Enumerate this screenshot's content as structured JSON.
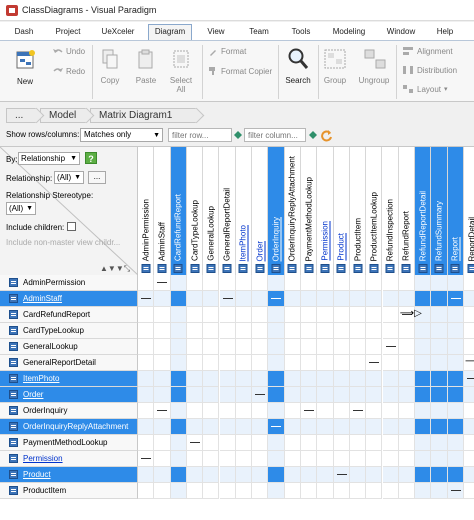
{
  "window": {
    "title": "ClassDiagrams - Visual Paradigm"
  },
  "menu": {
    "tabs": [
      {
        "label": "Dash",
        "active": false
      },
      {
        "label": "Project",
        "active": false
      },
      {
        "label": "UeXceler",
        "active": false
      },
      {
        "label": "Diagram",
        "active": true
      },
      {
        "label": "View",
        "active": false
      },
      {
        "label": "Team",
        "active": false
      },
      {
        "label": "Tools",
        "active": false
      },
      {
        "label": "Modeling",
        "active": false
      },
      {
        "label": "Window",
        "active": false
      },
      {
        "label": "Help",
        "active": false
      }
    ]
  },
  "ribbon": {
    "new": "New",
    "undo": "Undo",
    "redo": "Redo",
    "copy": "Copy",
    "paste": "Paste",
    "select_all": "Select",
    "select_all_line2": "All",
    "format": "Format",
    "format_copier": "Format Copier",
    "search": "Search",
    "group": "Group",
    "ungroup": "Ungroup",
    "alignment": "Alignment",
    "distribution": "Distribution",
    "layout": "Layout"
  },
  "breadcrumbs": {
    "ellipsis": "...",
    "model": "Model",
    "diagram": "Matrix Diagram1"
  },
  "filter": {
    "label": "Show rows/columns:",
    "value": "Matches only",
    "row_placeholder": "filter row...",
    "column_placeholder": "filter column..."
  },
  "corner": {
    "by_label": "By:",
    "by_value": "Relationship",
    "relationship_label": "Relationship:",
    "relationship_value": "(All)",
    "more_button": "...",
    "stereotype_label": "Relationship Stereotype:",
    "stereotype_value": "(All)",
    "include_children": "Include children:",
    "include_nonmaster": "Include non-master view childr...",
    "help": "?"
  },
  "columns": [
    {
      "name": "AdminPermission",
      "selected": false,
      "link": false
    },
    {
      "name": "AdminStaff",
      "selected": false,
      "link": false
    },
    {
      "name": "CardRefundReport",
      "selected": true,
      "link": false
    },
    {
      "name": "CardTypeLookup",
      "selected": false,
      "link": false
    },
    {
      "name": "GeneralLookup",
      "selected": false,
      "link": false
    },
    {
      "name": "GeneralReportDetail",
      "selected": false,
      "link": false
    },
    {
      "name": "ItemPhoto",
      "selected": false,
      "link": true
    },
    {
      "name": "Order",
      "selected": false,
      "link": true
    },
    {
      "name": "OrderInquiry",
      "selected": true,
      "link": true
    },
    {
      "name": "OrderInquiryReplyAttachment",
      "selected": false,
      "link": false
    },
    {
      "name": "PaymentMethodLookup",
      "selected": false,
      "link": false
    },
    {
      "name": "Permission",
      "selected": false,
      "link": true
    },
    {
      "name": "Product",
      "selected": false,
      "link": true
    },
    {
      "name": "ProductItem",
      "selected": false,
      "link": false
    },
    {
      "name": "ProductItemLookup",
      "selected": false,
      "link": false
    },
    {
      "name": "RefundInspection",
      "selected": false,
      "link": false
    },
    {
      "name": "RefundReport",
      "selected": false,
      "link": false
    },
    {
      "name": "RefundReportDetail",
      "selected": true,
      "link": false
    },
    {
      "name": "RefundSummary",
      "selected": true,
      "link": false
    },
    {
      "name": "Report",
      "selected": true,
      "link": true
    },
    {
      "name": "ReportDetail",
      "selected": false,
      "link": false
    }
  ],
  "rows": [
    {
      "name": "AdminPermission",
      "selected": false,
      "link": false
    },
    {
      "name": "AdminStaff",
      "selected": true,
      "link": true
    },
    {
      "name": "CardRefundReport",
      "selected": false,
      "link": false
    },
    {
      "name": "CardTypeLookup",
      "selected": false,
      "link": false
    },
    {
      "name": "GeneralLookup",
      "selected": false,
      "link": false
    },
    {
      "name": "GeneralReportDetail",
      "selected": false,
      "link": false
    },
    {
      "name": "ItemPhoto",
      "selected": true,
      "link": true
    },
    {
      "name": "Order",
      "selected": true,
      "link": true
    },
    {
      "name": "OrderInquiry",
      "selected": false,
      "link": false
    },
    {
      "name": "OrderInquiryReplyAttachment",
      "selected": true,
      "link": false
    },
    {
      "name": "PaymentMethodLookup",
      "selected": false,
      "link": false
    },
    {
      "name": "Permission",
      "selected": false,
      "link": true
    },
    {
      "name": "Product",
      "selected": true,
      "link": true
    },
    {
      "name": "ProductItem",
      "selected": false,
      "link": false
    }
  ],
  "dashes": [
    [
      0,
      1
    ],
    [
      1,
      0
    ],
    [
      1,
      5
    ],
    [
      1,
      8
    ],
    [
      1,
      19
    ],
    [
      2,
      16
    ],
    [
      4,
      15
    ],
    [
      5,
      14
    ],
    [
      6,
      20
    ],
    [
      7,
      7
    ],
    [
      8,
      1
    ],
    [
      8,
      10
    ],
    [
      8,
      13
    ],
    [
      9,
      8
    ],
    [
      10,
      3
    ],
    [
      11,
      0
    ],
    [
      12,
      12
    ],
    [
      13,
      19
    ]
  ],
  "arrows": [
    {
      "row": 2,
      "col": 16,
      "glyph": "⟶▷",
      "colspan": 2
    },
    {
      "row": 5,
      "col": 20,
      "glyph": "⟶"
    }
  ],
  "colors": {
    "selected": "#2e8be8",
    "link": "#0033cc",
    "icon": "#3d74b8"
  }
}
